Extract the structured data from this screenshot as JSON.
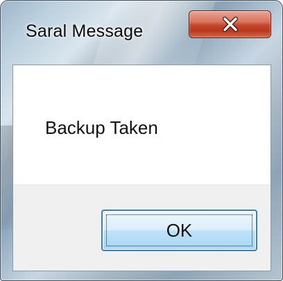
{
  "window": {
    "title": "Saral Message"
  },
  "title_bar": {
    "close_icon": "close-icon"
  },
  "message": {
    "text": "Backup Taken"
  },
  "buttons": {
    "ok_label": "OK"
  },
  "colors": {
    "close_button": "#c4452a",
    "ok_button_border": "#3c7fb1",
    "footer_background": "#f0f0f0"
  }
}
